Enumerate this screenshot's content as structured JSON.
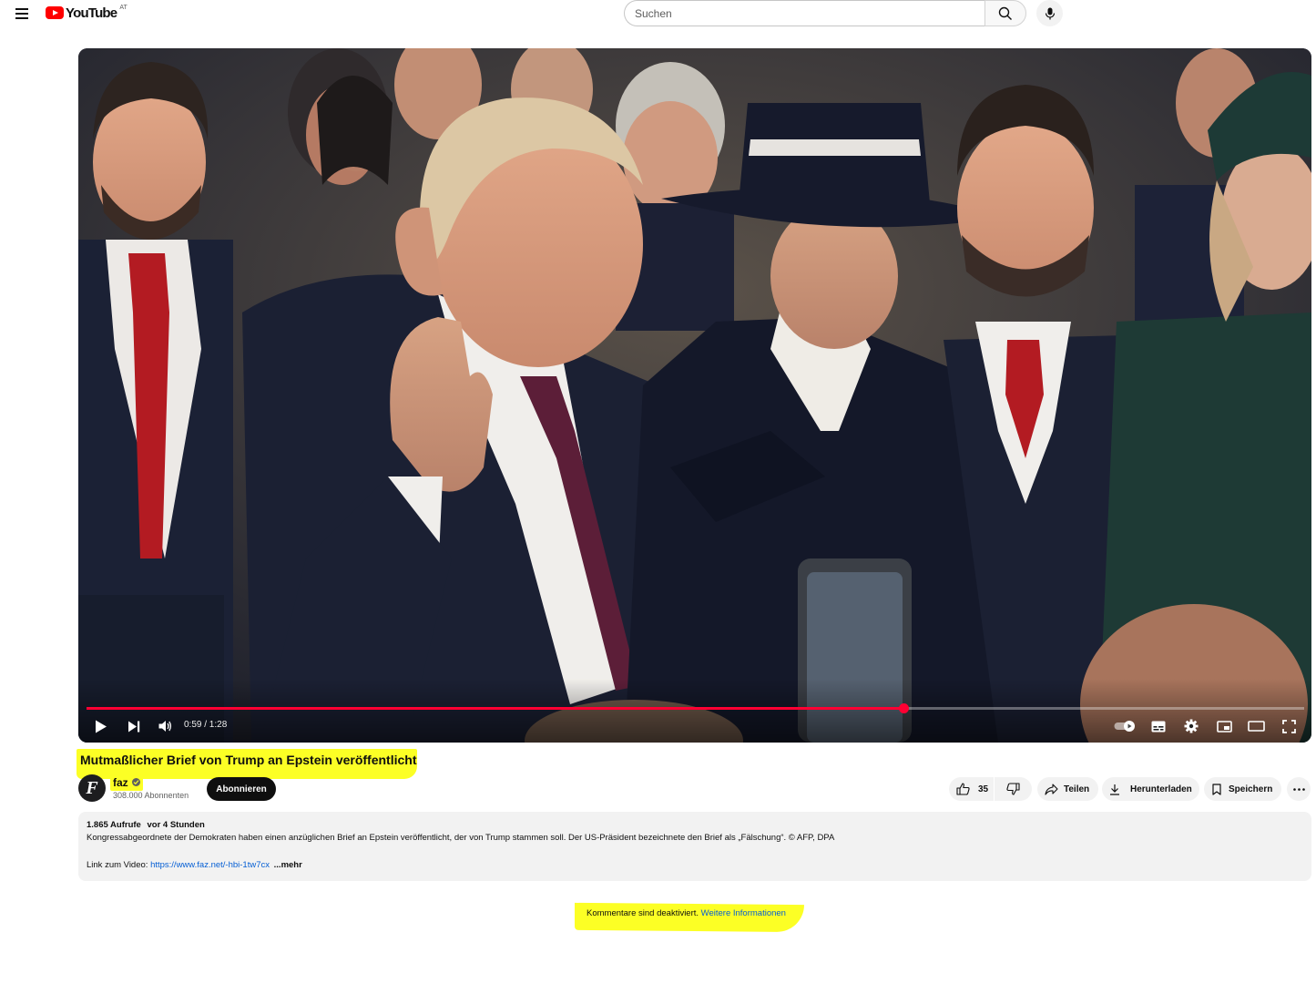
{
  "masthead": {
    "menu_icon": "hamburger-menu-icon",
    "logo_text": "YouTube",
    "country_code": "AT",
    "search_placeholder": "Suchen",
    "search_value": "",
    "search_icon": "search-icon",
    "mic_icon": "microphone-icon"
  },
  "player": {
    "time_display": "0:59 / 1:28",
    "played_fraction": 0.671,
    "controls": [
      "play-icon",
      "next-icon",
      "volume-icon",
      "autoplay-toggle-icon",
      "subtitles-icon",
      "settings-gear-icon",
      "miniplayer-icon",
      "theater-mode-icon",
      "fullscreen-icon"
    ],
    "accent_color": "#ff0033"
  },
  "video": {
    "title": "Mutmaßlicher Brief von Trump an Epstein veröffentlicht",
    "channel_name": "faz",
    "subscribers": "308.000 Abonnenten",
    "subscribe_label": "Abonnieren",
    "likes": "35",
    "share_label": "Teilen",
    "download_label": "Herunterladen",
    "save_label": "Speichern"
  },
  "description": {
    "views": "1.865 Aufrufe",
    "age": "vor 4 Stunden",
    "text": "Kongressabgeordnete der Demokraten haben einen anzüglichen Brief an Epstein veröffentlicht, der von Trump stammen soll. Der US-Präsident bezeichnete den Brief als „Fälschung“.  © AFP, DPA",
    "link_prefix": "Link zum Video: ",
    "link_url": "https://www.faz.net/-hbi-1tw7cx",
    "more_label": "...mehr"
  },
  "comments": {
    "disabled_text": "Kommentare sind deaktiviert.",
    "more_info_label": "Weitere Informationen"
  },
  "highlight_color": "#fcff25"
}
